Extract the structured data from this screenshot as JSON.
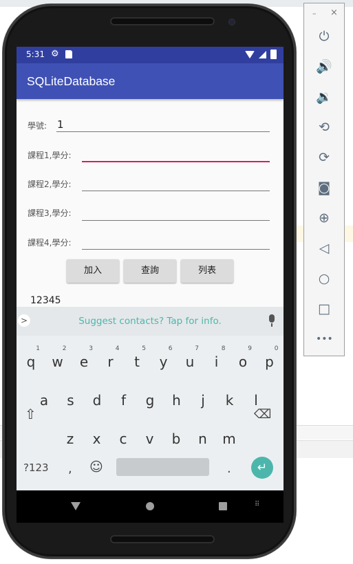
{
  "statusbar": {
    "time": "5:31",
    "gear_icon": "settings-icon",
    "sd_icon": "sd-card-icon"
  },
  "app": {
    "title": "SQLiteDatabase"
  },
  "form": {
    "student_id_label": "學號:",
    "student_id_value": "1",
    "course1_label": "課程1,學分:",
    "course2_label": "課程2,學分:",
    "course3_label": "課程3,學分:",
    "course4_label": "課程4,學分:",
    "course1_value": "",
    "course2_value": "",
    "course3_value": "",
    "course4_value": ""
  },
  "buttons": {
    "add": "加入",
    "query": "查詢",
    "list": "列表"
  },
  "output_text": "12345",
  "keyboard": {
    "suggestion": "Suggest contacts? Tap for info.",
    "row1": [
      "q",
      "w",
      "e",
      "r",
      "t",
      "y",
      "u",
      "i",
      "o",
      "p"
    ],
    "row1_hints": [
      "1",
      "2",
      "3",
      "4",
      "5",
      "6",
      "7",
      "8",
      "9",
      "0"
    ],
    "row2": [
      "a",
      "s",
      "d",
      "f",
      "g",
      "h",
      "j",
      "k",
      "l"
    ],
    "row3": [
      "z",
      "x",
      "c",
      "v",
      "b",
      "n",
      "m"
    ],
    "symbols_key": "?123",
    "comma_key": ",",
    "period_key": "."
  },
  "colors": {
    "primary": "#3f51b5",
    "primary_dark": "#303f9f",
    "accent": "#d81b60",
    "keyboard_accent": "#4db6ac"
  },
  "icons": {
    "toolbar": [
      "power-icon",
      "volume-up-icon",
      "volume-down-icon",
      "rotate-left-icon",
      "rotate-right-icon",
      "camera-icon",
      "zoom-icon",
      "back-icon",
      "home-icon",
      "overview-icon",
      "more-icon"
    ]
  }
}
